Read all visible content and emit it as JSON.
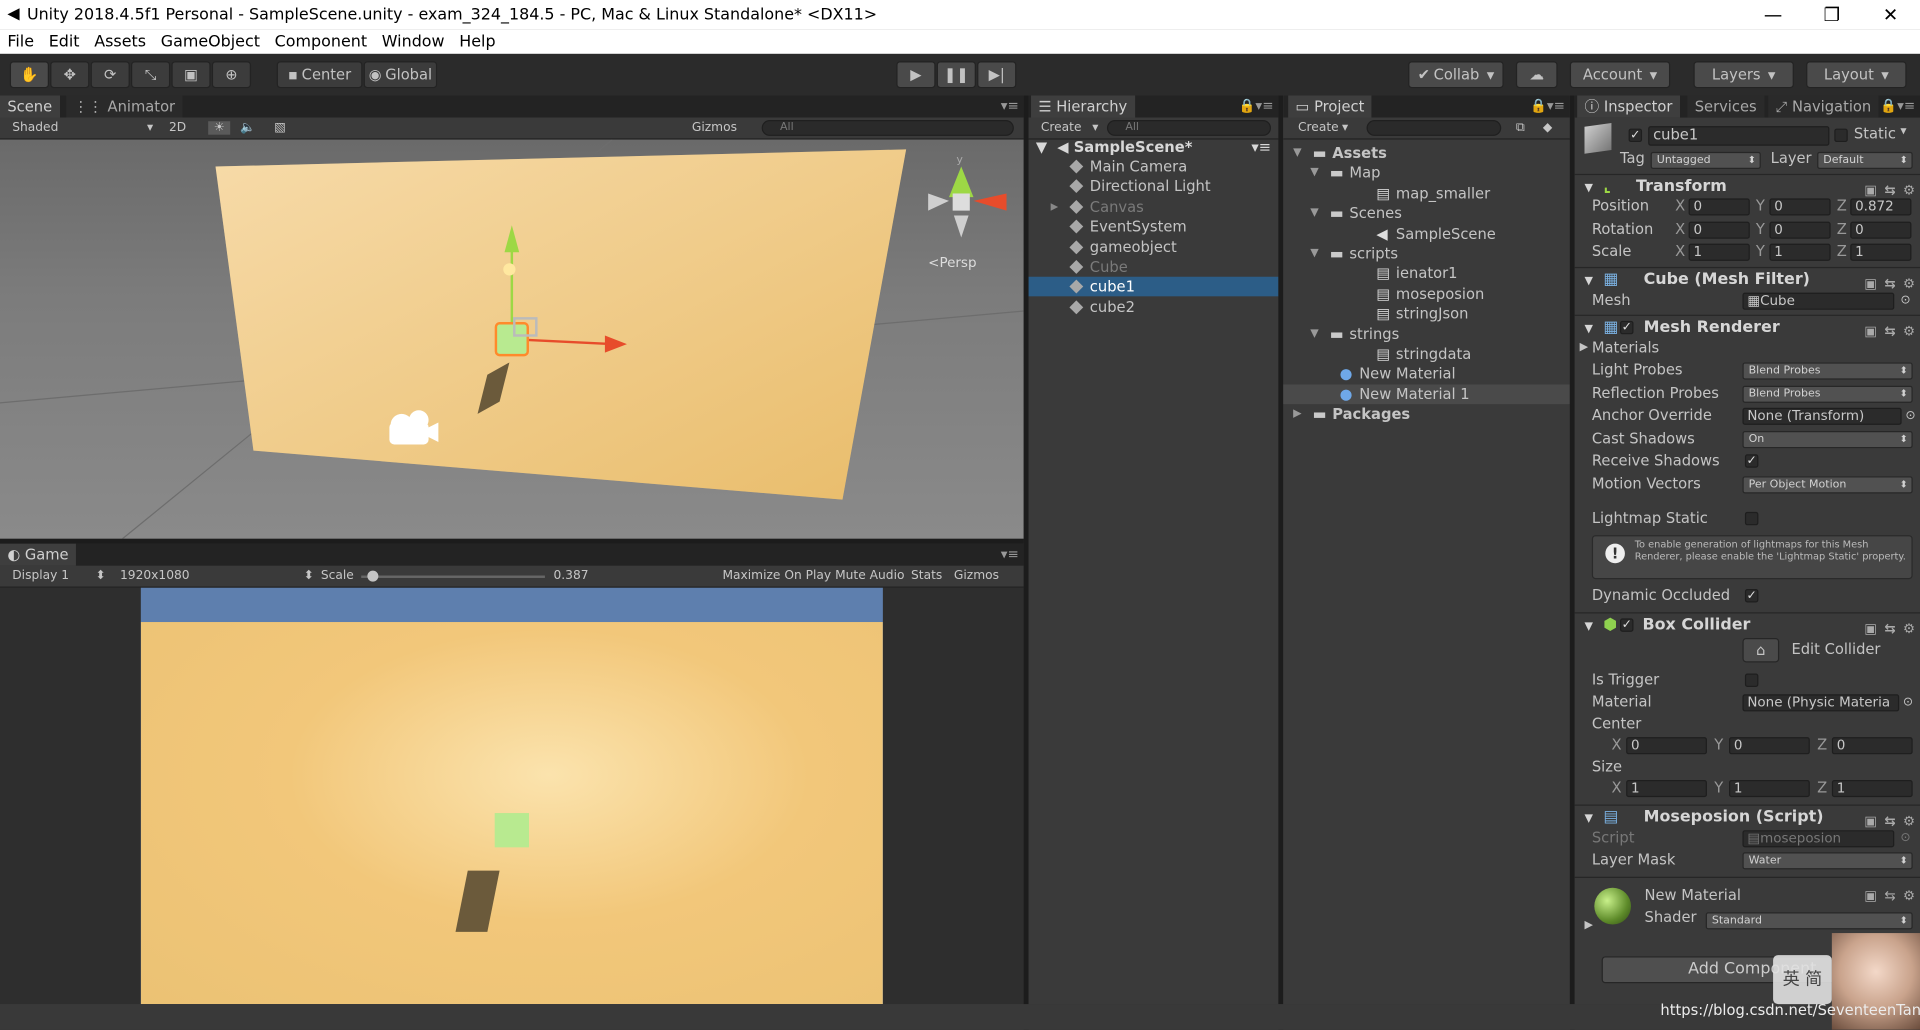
{
  "window": {
    "title": "Unity 2018.4.5f1 Personal - SampleScene.unity - exam_324_184.5 - PC, Mac & Linux Standalone* <DX11>",
    "minimize": "—",
    "restore": "❐",
    "close": "✕"
  },
  "menu": [
    "File",
    "Edit",
    "Assets",
    "GameObject",
    "Component",
    "Window",
    "Help"
  ],
  "toolbar": {
    "center": "Center",
    "global": "Global",
    "collab": "Collab",
    "account": "Account",
    "layers": "Layers",
    "layout": "Layout"
  },
  "scene": {
    "tabs": [
      "Scene",
      "Animator"
    ],
    "shading": "Shaded",
    "mode_2d": "2D",
    "gizmos": "Gizmos",
    "search": "All",
    "persp": "Persp",
    "gizmo_y": "y"
  },
  "game": {
    "tab": "Game",
    "display": "Display 1",
    "resolution": "1920x1080",
    "scale_label": "Scale",
    "scale_value": "0.387",
    "scale_fraction": 0.387,
    "maximize": "Maximize On Play",
    "mute": "Mute Audio",
    "stats": "Stats",
    "gizmos": "Gizmos"
  },
  "hierarchy": {
    "tab": "Hierarchy",
    "create": "Create",
    "search": "All",
    "scene": "SampleScene*",
    "items": [
      {
        "label": "Main Camera",
        "dim": false
      },
      {
        "label": "Directional Light",
        "dim": false
      },
      {
        "label": "Canvas",
        "dim": true
      },
      {
        "label": "EventSystem",
        "dim": false
      },
      {
        "label": "gameobject",
        "dim": false
      },
      {
        "label": "Cube",
        "dim": true
      },
      {
        "label": "cube1",
        "dim": false
      },
      {
        "label": "cube2",
        "dim": false
      }
    ]
  },
  "project": {
    "tab": "Project",
    "create": "Create",
    "items": [
      {
        "label": "Assets",
        "bold": true
      },
      {
        "label": "Map"
      },
      {
        "label": "map_smaller"
      },
      {
        "label": "Scenes"
      },
      {
        "label": "SampleScene"
      },
      {
        "label": "scripts"
      },
      {
        "label": "ienator1"
      },
      {
        "label": "moseposion"
      },
      {
        "label": "stringJson"
      },
      {
        "label": "strings"
      },
      {
        "label": "stringdata"
      },
      {
        "label": "New Material"
      },
      {
        "label": "New Material 1"
      },
      {
        "label": "Packages",
        "bold": true
      }
    ]
  },
  "inspector": {
    "tabs": [
      "Inspector",
      "Services",
      "Navigation"
    ],
    "object_name": "cube1",
    "static": "Static",
    "tag_label": "Tag",
    "tag": "Untagged",
    "layer_label": "Layer",
    "layer": "Default",
    "transform": {
      "title": "Transform",
      "position_label": "Position",
      "rotation_label": "Rotation",
      "scale_label": "Scale",
      "x": "X",
      "y": "Y",
      "z": "Z",
      "position": [
        "0",
        "0",
        "0.872"
      ],
      "rotation": [
        "0",
        "0",
        "0"
      ],
      "scale": [
        "1",
        "1",
        "1"
      ]
    },
    "mesh_filter": {
      "title": "Cube (Mesh Filter)",
      "mesh_label": "Mesh",
      "mesh": "Cube"
    },
    "mesh_renderer": {
      "title": "Mesh Renderer",
      "materials": "Materials",
      "light_probes_label": "Light Probes",
      "light_probes": "Blend Probes",
      "reflection_label": "Reflection Probes",
      "reflection": "Blend Probes",
      "anchor_label": "Anchor Override",
      "anchor": "None (Transform)",
      "cast_label": "Cast Shadows",
      "cast": "On",
      "receive_label": "Receive Shadows",
      "motion_label": "Motion Vectors",
      "motion": "Per Object Motion",
      "lightmap_label": "Lightmap Static",
      "info": "To enable generation of lightmaps for this Mesh Renderer, please enable the 'Lightmap Static' property.",
      "occluded_label": "Dynamic Occluded"
    },
    "box_collider": {
      "title": "Box Collider",
      "edit": "Edit Collider",
      "trigger_label": "Is Trigger",
      "material_label": "Material",
      "material": "None (Physic Materia",
      "center_label": "Center",
      "center": [
        "0",
        "0",
        "0"
      ],
      "size_label": "Size",
      "size": [
        "1",
        "1",
        "1"
      ]
    },
    "script": {
      "title": "Moseposion (Script)",
      "script_label": "Script",
      "script": "moseposion",
      "mask_label": "Layer Mask",
      "mask": "Water"
    },
    "material": {
      "name": "New Material",
      "shader_label": "Shader",
      "shader": "Standard"
    },
    "add_component": "Add Component"
  },
  "watermark": {
    "ime": "英 简",
    "url": "https://blog.csdn.net/SeventeenTan"
  },
  "colors": {
    "selection": "#2c5d87",
    "wall": "#f2c77a",
    "sky": "#5e7fae",
    "cube": "#b8ea90"
  }
}
